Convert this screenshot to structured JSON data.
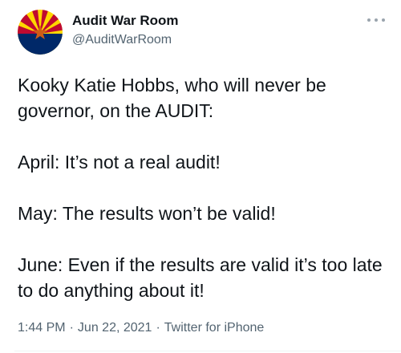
{
  "author": {
    "display_name": "Audit War Room",
    "handle": "@AuditWarRoom",
    "avatar_icon": "arizona-flag-icon"
  },
  "more_icon": "more-options-icon",
  "tweet": {
    "paragraphs": [
      "Kooky Katie Hobbs, who will never be governor, on the AUDIT:",
      "April: It’s not a real audit!",
      "May: The results won’t be valid!",
      "June: Even if the results are valid it’s too late to do anything about it!"
    ]
  },
  "meta": {
    "time": "1:44 PM",
    "separator": "·",
    "date": "Jun 22, 2021",
    "source": "Twitter for iPhone"
  },
  "colors": {
    "text_primary": "#0f1419",
    "text_secondary": "#536471",
    "flag_red": "#bf0a30",
    "flag_yellow": "#fed700",
    "flag_blue": "#002868",
    "flag_star": "#ce5c17"
  }
}
